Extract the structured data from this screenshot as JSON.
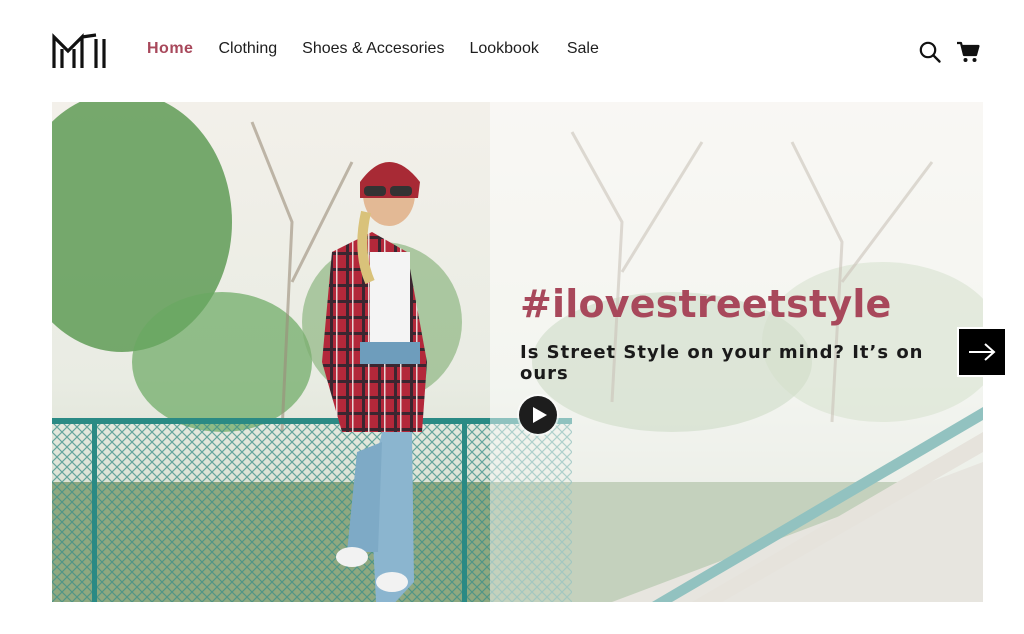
{
  "brand": {
    "logo_name": "MI monogram logo"
  },
  "nav": {
    "items": [
      {
        "label": "Home",
        "active": true
      },
      {
        "label": "Clothing",
        "active": false
      },
      {
        "label": "Shoes & Accesories",
        "active": false
      },
      {
        "label": "Lookbook",
        "active": false
      },
      {
        "label": "Sale",
        "active": false
      }
    ]
  },
  "header_icons": {
    "search": "search-icon",
    "cart": "cart-icon"
  },
  "hero": {
    "headline": "#ilovestreetstyle",
    "subheading": "Is Street Style on your mind? It’s on ours",
    "play_icon": "play-icon",
    "next_icon": "arrow-right-icon"
  },
  "colors": {
    "accent": "#a8485b",
    "text": "#1e1e1e",
    "background": "#ffffff"
  }
}
